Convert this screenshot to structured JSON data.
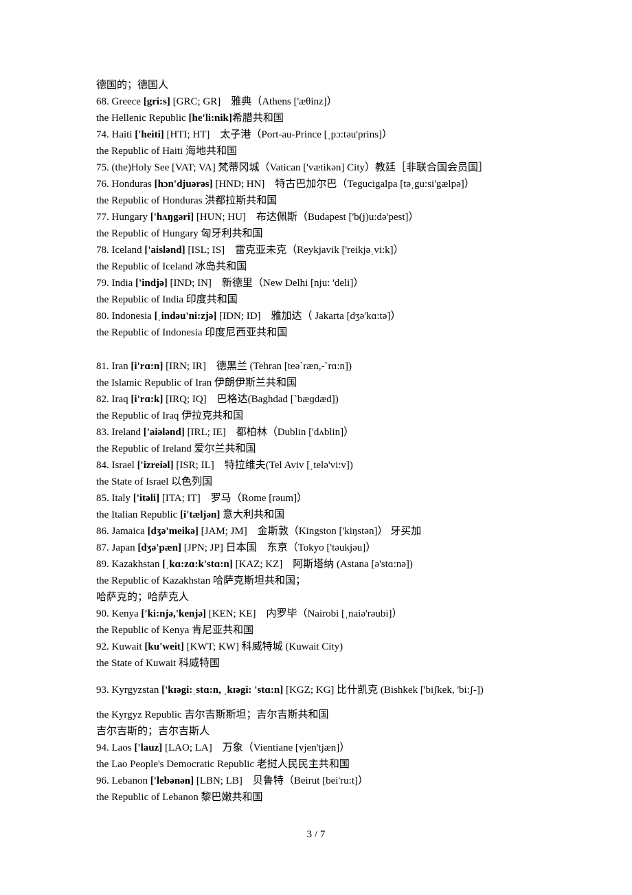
{
  "lines": [
    {
      "segments": [
        {
          "t": "德国的；德国人"
        }
      ]
    },
    {
      "segments": [
        {
          "t": "68. Greece "
        },
        {
          "t": "[gri:s]",
          "b": true
        },
        {
          "t": " [GRC; GR]　雅典（Athens ['æθinz]）"
        }
      ]
    },
    {
      "segments": [
        {
          "t": "the Hellenic Republic "
        },
        {
          "t": "[he'li:nik]",
          "b": true
        },
        {
          "t": "希腊共和国"
        }
      ]
    },
    {
      "segments": [
        {
          "t": "74. Haiti "
        },
        {
          "t": "['heiti]",
          "b": true
        },
        {
          "t": " [HTI; HT]　太子港（Port-au-Prince [ˌpɔ:təu'prins]）"
        }
      ]
    },
    {
      "segments": [
        {
          "t": "the Republic of Haiti  海地共和国"
        }
      ]
    },
    {
      "segments": [
        {
          "t": "75. (the)Holy See [VAT; VA]  梵蒂冈城（Vatican ['vætikən] City）教廷［非联合国会员国］"
        }
      ]
    },
    {
      "segments": [
        {
          "t": "76. Honduras "
        },
        {
          "t": "[hɔn'djuərəs]",
          "b": true
        },
        {
          "t": " [HND; HN]　特古巴加尔巴（Tegucigalpa [təˌgu:si'gælpə]）"
        }
      ]
    },
    {
      "segments": [
        {
          "t": "the Republic of Honduras  洪都拉斯共和国"
        }
      ]
    },
    {
      "segments": [
        {
          "t": "77. Hungary "
        },
        {
          "t": "['hʌŋgəri]",
          "b": true
        },
        {
          "t": " [HUN; HU]　布达佩斯（Budapest ['b(j)u:də'pest]）"
        }
      ]
    },
    {
      "segments": [
        {
          "t": "the Republic of Hungary  匈牙利共和国"
        }
      ]
    },
    {
      "segments": [
        {
          "t": "78. Iceland "
        },
        {
          "t": "['aislənd]",
          "b": true
        },
        {
          "t": " [ISL; IS]　雷克亚未克（Reykjavik ['reikjəˌvi:k]）"
        }
      ]
    },
    {
      "segments": [
        {
          "t": "the Republic of Iceland  冰岛共和国"
        }
      ]
    },
    {
      "segments": [
        {
          "t": "79. India "
        },
        {
          "t": "['indjə]",
          "b": true
        },
        {
          "t": " [IND; IN]　新德里（New Delhi [nju: 'deli]）"
        }
      ]
    },
    {
      "segments": [
        {
          "t": "the Republic of India  印度共和国"
        }
      ]
    },
    {
      "segments": [
        {
          "t": "80. Indonesia "
        },
        {
          "t": "[ˌindəu'ni:zjə]",
          "b": true
        },
        {
          "t": " [IDN; ID]　雅加达（ Jakarta [dʒə'kɑ:tə]）"
        }
      ]
    },
    {
      "segments": [
        {
          "t": "the Republic of Indonesia  印度尼西亚共和国"
        }
      ]
    },
    {
      "segments": [
        {
          "t": "81. Iran "
        },
        {
          "t": "[i'rɑ:n]",
          "b": true
        },
        {
          "t": " [IRN; IR]　德黑兰  (Tehran [teə`ræn,-`rɑ:n])"
        }
      ]
    },
    {
      "segments": [
        {
          "t": "the Islamic Republic of Iran  伊朗伊斯兰共和国"
        }
      ]
    },
    {
      "segments": [
        {
          "t": "82. Iraq "
        },
        {
          "t": "[i'rɑ:k]",
          "b": true
        },
        {
          "t": " [IRQ; IQ]　巴格达(Baghdad [`bæɡdæd])"
        }
      ]
    },
    {
      "segments": [
        {
          "t": "the Republic of Iraq  伊拉克共和国"
        }
      ]
    },
    {
      "segments": [
        {
          "t": "83. Ireland "
        },
        {
          "t": "['aiələnd]",
          "b": true
        },
        {
          "t": " [IRL; IE]　都柏林（Dublin ['dʌblin]）"
        }
      ]
    },
    {
      "segments": [
        {
          "t": "the Republic of Ireland 爱尔兰共和国"
        }
      ]
    },
    {
      "segments": [
        {
          "t": "84. Israel "
        },
        {
          "t": "['izreiəl]",
          "b": true
        },
        {
          "t": " [ISR; IL]　特拉维夫(Tel Aviv [ˌtelə'vi:v])"
        }
      ]
    },
    {
      "segments": [
        {
          "t": "the State of Israel  以色列国"
        }
      ]
    },
    {
      "segments": [
        {
          "t": "85. Italy "
        },
        {
          "t": "['itəli]",
          "b": true
        },
        {
          "t": " [ITA; IT]　罗马（Rome [rəum]）"
        }
      ]
    },
    {
      "segments": [
        {
          "t": "the Italian Republic "
        },
        {
          "t": "[i'tæljən]",
          "b": true
        },
        {
          "t": "  意大利共和国"
        }
      ]
    },
    {
      "segments": [
        {
          "t": "86. Jamaica "
        },
        {
          "t": "[dʒə'meikə]",
          "b": true
        },
        {
          "t": " [JAM; JM]　金斯敦（Kingston ['kiŋstən]）  牙买加"
        }
      ]
    },
    {
      "segments": [
        {
          "t": "87. Japan "
        },
        {
          "t": "[dʒə'pæn]",
          "b": true
        },
        {
          "t": " [JPN; JP]  日本国　东京（Tokyo ['təukjəu]）"
        }
      ]
    },
    {
      "segments": [
        {
          "t": "89. Kazakhstan "
        },
        {
          "t": "[ˌkɑ:zɑ:k'stɑ:n]",
          "b": true
        },
        {
          "t": " [KAZ; KZ]　阿斯塔纳  (Astana [ə'stɑ:nə])"
        }
      ]
    },
    {
      "segments": [
        {
          "t": "the Republic of Kazakhstan  哈萨克斯坦共和国；"
        }
      ]
    },
    {
      "segments": [
        {
          "t": "哈萨克的；哈萨克人"
        }
      ]
    },
    {
      "segments": [
        {
          "t": "90. Kenya "
        },
        {
          "t": "['ki:njə,'kenjə]",
          "b": true
        },
        {
          "t": " [KEN; KE]　内罗毕（Nairobi [ˌnaiə'rəubi]）"
        }
      ]
    },
    {
      "segments": [
        {
          "t": "the Republic of Kenya  肯尼亚共和国"
        }
      ]
    },
    {
      "segments": [
        {
          "t": "92. Kuwait "
        },
        {
          "t": "[ku'weit]",
          "b": true
        },
        {
          "t": " [KWT; KW]  科威特城  (Kuwait City)"
        }
      ]
    },
    {
      "segments": [
        {
          "t": "the State of Kuwait  科威特国"
        }
      ]
    },
    {
      "segments": [
        {
          "t": "93. Kyrgyzstan "
        },
        {
          "t": "['kɪəgi:ˌstɑ:n,  ˌkɪəgi: 'stɑ:n]",
          "b": true
        },
        {
          "t": " [KGZ; KG]  比什凯克  (Bishkek ['biʃkek, 'bi:ʃ-])"
        }
      ]
    },
    {
      "segments": [
        {
          "t": "the Kyrgyz Republic  吉尔吉斯斯坦；吉尔吉斯共和国"
        }
      ]
    },
    {
      "segments": [
        {
          "t": "吉尔吉斯的；吉尔吉斯人"
        }
      ]
    },
    {
      "segments": [
        {
          "t": "94. Laos "
        },
        {
          "t": "['lauz]",
          "b": true
        },
        {
          "t": " [LAO; LA]　万象（Vientiane [vjen'tjæn]）"
        }
      ]
    },
    {
      "segments": [
        {
          "t": "the Lao People's Democratic Republic  老挝人民民主共和国"
        }
      ]
    },
    {
      "segments": [
        {
          "t": "96. Lebanon "
        },
        {
          "t": "['lebənən]",
          "b": true
        },
        {
          "t": " [LBN; LB]　贝鲁特（Beirut [bei'ru:t]）"
        }
      ]
    },
    {
      "segments": [
        {
          "t": "the Republic of Lebanon  黎巴嫩共和国"
        }
      ]
    }
  ],
  "page_number": "3  / 7"
}
